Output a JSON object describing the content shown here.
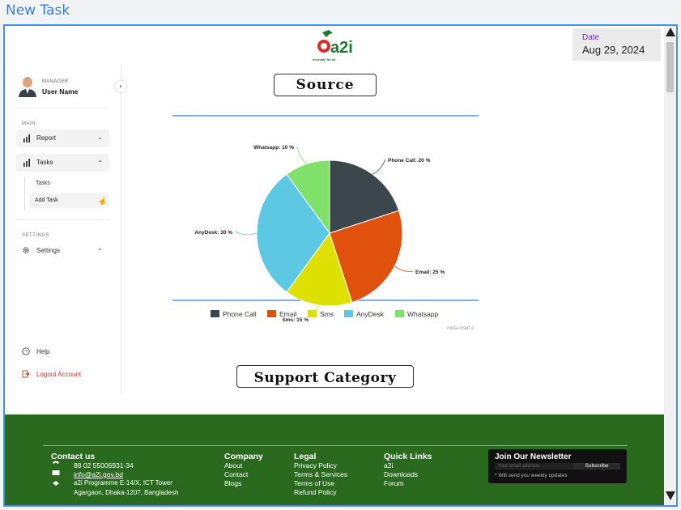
{
  "window": {
    "title": "New Task"
  },
  "logo": {
    "text": "a2i",
    "tagline": "innovate for all"
  },
  "date": {
    "label": "Date",
    "value": "Aug 29, 2024"
  },
  "user": {
    "role": "MANAGER",
    "name": "User Name"
  },
  "sidebar": {
    "main_label": "MAIN",
    "report_label": "Report",
    "tasks_label": "Tasks",
    "sub_items": [
      "Tasks",
      "Add Task"
    ],
    "settings_section_label": "SETTINGS",
    "settings_label": "Settings",
    "help_label": "Help",
    "logout_label": "Logout Account"
  },
  "sections": {
    "source_title": "Source",
    "support_title": "Support Category"
  },
  "chart_data": {
    "type": "pie",
    "categories": [
      "Phone Call",
      "Email",
      "Sms",
      "AnyDesk",
      "Whatsapp"
    ],
    "values": [
      20,
      25,
      15,
      30,
      10
    ],
    "labels": [
      "Phone Call: 20 %",
      "Email: 25 %",
      "Sms: 15 %",
      "AnyDesk: 30 %",
      "Whatsapp: 10 %"
    ],
    "colors": [
      "#3c464d",
      "#e0510e",
      "#dde000",
      "#5cc8e4",
      "#7fe06a"
    ],
    "legend": "bottom",
    "credit": "meta-chart.c"
  },
  "footer": {
    "contact": {
      "title": "Contact us",
      "phone": "88 02 55006931-34",
      "email": "info@a2i.gov.bd",
      "address_line1": "a2i Programme E-14/X, ICT Tower",
      "address_line2": "Agargaon, Dhaka-1207, Bangladesh"
    },
    "company": {
      "title": "Company",
      "items": [
        "About",
        "Contact",
        "Blogs"
      ]
    },
    "legal": {
      "title": "Legal",
      "items": [
        "Privacy Policy",
        "Terms & Services",
        "Terms of Use",
        "Refund Policy"
      ]
    },
    "quick": {
      "title": "Quick Links",
      "items": [
        "a2i",
        "Downloads",
        "Forum"
      ]
    },
    "newsletter": {
      "title": "Join Our Newsletter",
      "placeholder": "Your email address",
      "button": "Subscribe",
      "note": "* Will send you weekly updates"
    }
  }
}
